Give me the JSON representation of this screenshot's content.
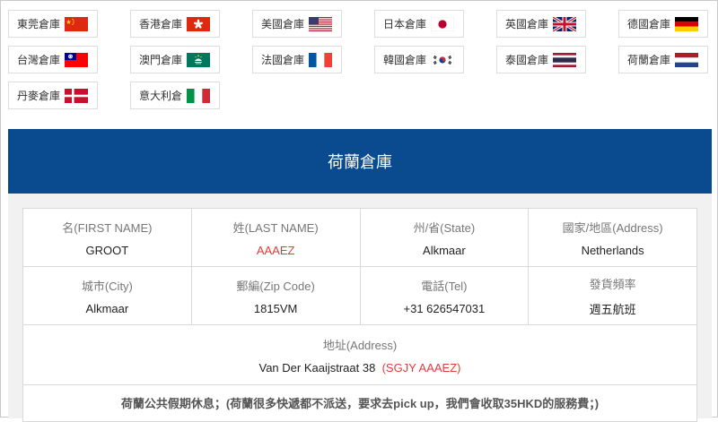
{
  "warehouses": [
    {
      "label": "東莞倉庫",
      "flag": "cn"
    },
    {
      "label": "香港倉庫",
      "flag": "hk"
    },
    {
      "label": "美國倉庫",
      "flag": "us"
    },
    {
      "label": "日本倉庫",
      "flag": "jp"
    },
    {
      "label": "英國倉庫",
      "flag": "uk"
    },
    {
      "label": "德國倉庫",
      "flag": "de"
    },
    {
      "label": "台灣倉庫",
      "flag": "tw"
    },
    {
      "label": "澳門倉庫",
      "flag": "mo"
    },
    {
      "label": "法國倉庫",
      "flag": "fr"
    },
    {
      "label": "韓國倉庫",
      "flag": "kr"
    },
    {
      "label": "泰國倉庫",
      "flag": "th"
    },
    {
      "label": "荷蘭倉庫",
      "flag": "nl"
    },
    {
      "label": "丹麥倉庫",
      "flag": "dk"
    },
    {
      "label": "意大利倉",
      "flag": "it"
    }
  ],
  "banner": {
    "title": "荷蘭倉庫"
  },
  "info": {
    "first_name": {
      "label": "名(FIRST NAME)",
      "value": "GROOT"
    },
    "last_name": {
      "label": "姓(LAST NAME)",
      "value": "AAAEZ"
    },
    "state": {
      "label": "州/省(State)",
      "value": "Alkmaar"
    },
    "country": {
      "label": "國家/地區(Address)",
      "value": "Netherlands"
    },
    "city": {
      "label": "城市(City)",
      "value": "Alkmaar"
    },
    "zip": {
      "label": "郵編(Zip Code)",
      "value": "1815VM"
    },
    "tel": {
      "label": "電話(Tel)",
      "value": "+31 626547031"
    },
    "frequency": {
      "label": "發貨頻率",
      "value": "週五航班"
    },
    "address": {
      "label": "地址(Address)",
      "value": "Van Der Kaaijstraat 38",
      "code": "(SGJY AAAEZ)"
    },
    "note": "荷蘭公共假期休息；(荷蘭很多快遞都不派送，要求去pick up，我們會收取35HKD的服務費；)"
  },
  "colors": {
    "banner": "#0a4a8e",
    "accent_red": "#e23b3b"
  }
}
